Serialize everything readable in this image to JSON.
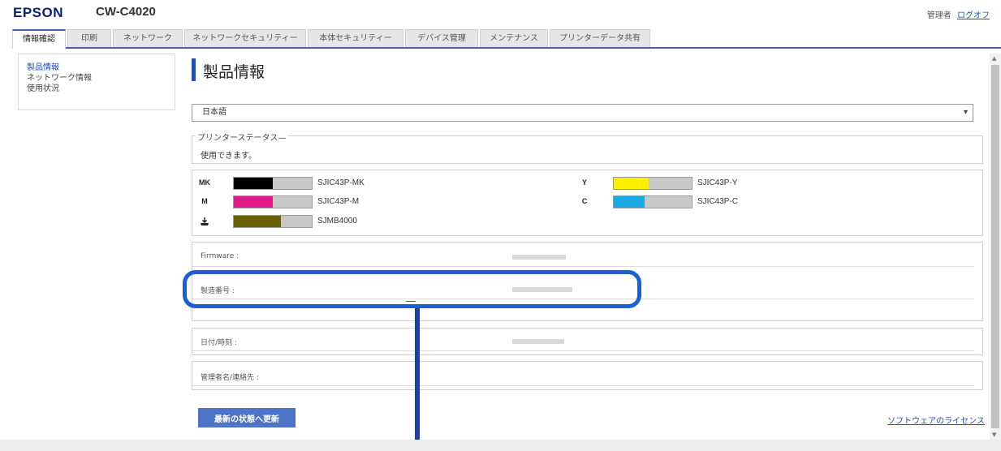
{
  "header": {
    "brand": "EPSON",
    "model": "CW-C4020",
    "user": "管理者",
    "logoff": "ログオフ"
  },
  "tabs": [
    {
      "label": "情報確認",
      "active": true
    },
    {
      "label": "印刷"
    },
    {
      "label": "ネットワーク"
    },
    {
      "label": "ネットワークセキュリティー"
    },
    {
      "label": "本体セキュリティー"
    },
    {
      "label": "デバイス管理"
    },
    {
      "label": "メンテナンス"
    },
    {
      "label": "プリンターデータ共有"
    }
  ],
  "sidebar": {
    "items": [
      {
        "label": "製品情報",
        "active": true
      },
      {
        "label": "ネットワーク情報"
      },
      {
        "label": "使用状況"
      }
    ]
  },
  "main": {
    "title": "製品情報",
    "language": "日本語",
    "status": {
      "legend": "プリンターステータス",
      "text": "使用できます。"
    },
    "inks": [
      {
        "label": "MK",
        "code": "SJIC43P-MK",
        "level": 0.5,
        "color": "#000000"
      },
      {
        "label": "M",
        "code": "SJIC43P-M",
        "level": 0.5,
        "color": "#e0198c"
      },
      {
        "label": "",
        "code": "SJMB4000",
        "level": 0.6,
        "color": "#6b6000"
      },
      {
        "label": "Y",
        "code": "SJIC43P-Y",
        "level": 0.45,
        "color": "#ffee00"
      },
      {
        "label": "C",
        "code": "SJIC43P-C",
        "level": 0.4,
        "color": "#1aa9e0"
      }
    ],
    "info": {
      "firmware": "Firmware :",
      "serial": "製造番号 :",
      "datetime": "日付/時刻 :",
      "admin": "管理者名/連絡先 :"
    },
    "refresh_button": "最新の状態へ更新",
    "license_link": "ソフトウェアのライセンス"
  },
  "colors": {
    "accent": "#1a4fbf",
    "highlight": "#1a5fd6"
  }
}
